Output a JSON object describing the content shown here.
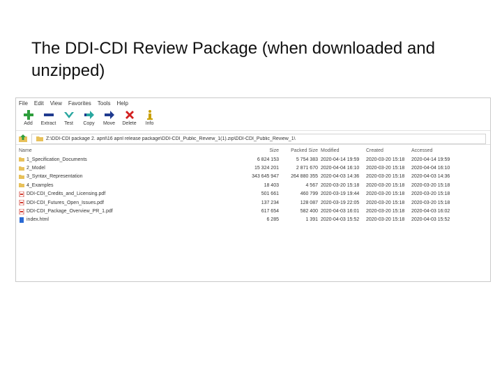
{
  "slide": {
    "title": "The DDI-CDI Review Package (when downloaded and unzipped)"
  },
  "menu": [
    "File",
    "Edit",
    "View",
    "Favorites",
    "Tools",
    "Help"
  ],
  "toolbar": [
    {
      "label": "Add",
      "icon": "add-icon"
    },
    {
      "label": "Extract",
      "icon": "extract-icon"
    },
    {
      "label": "Test",
      "icon": "test-icon"
    },
    {
      "label": "Copy",
      "icon": "copy-icon"
    },
    {
      "label": "Move",
      "icon": "move-icon"
    },
    {
      "label": "Delete",
      "icon": "delete-icon"
    },
    {
      "label": "Info",
      "icon": "info-icon"
    }
  ],
  "address": {
    "path": "Z:\\DDI-CDI package 2. april\\16 april release package\\DDI-CDI_Public_Review_1(1).zip\\DDI-CDI_Public_Review_1\\"
  },
  "columns": {
    "name": "Name",
    "size": "Size",
    "packed": "Packed Size",
    "modified": "Modified",
    "created": "Created",
    "accessed": "Accessed"
  },
  "files": [
    {
      "name": "1_Specification_Documents",
      "size": "6 824 153",
      "packed": "5 754 383",
      "modified": "2020-04-14 19:59",
      "created": "2020-03-20 15:18",
      "accessed": "2020-04-14 19:59",
      "type": "folder"
    },
    {
      "name": "2_Model",
      "size": "15 324 201",
      "packed": "2 871 670",
      "modified": "2020-04-04 16:10",
      "created": "2020-03-20 15:18",
      "accessed": "2020-04-04 16:10",
      "type": "folder"
    },
    {
      "name": "3_Syntax_Representation",
      "size": "343 645 947",
      "packed": "264 880 355",
      "modified": "2020-04-03 14:36",
      "created": "2020-03-20 15:18",
      "accessed": "2020-04-03 14:36",
      "type": "folder"
    },
    {
      "name": "4_Examples",
      "size": "18 403",
      "packed": "4 567",
      "modified": "2020-03-20 15:18",
      "created": "2020-03-20 15:18",
      "accessed": "2020-03-20 15:18",
      "type": "folder"
    },
    {
      "name": "DDI-CDI_Credits_and_Licensing.pdf",
      "size": "501 661",
      "packed": "460 799",
      "modified": "2020-03-19 19:44",
      "created": "2020-03-20 15:18",
      "accessed": "2020-03-20 15:18",
      "type": "pdf"
    },
    {
      "name": "DDI-CDI_Futures_Open_Issues.pdf",
      "size": "137 234",
      "packed": "128 087",
      "modified": "2020-03-19 22:05",
      "created": "2020-03-20 15:18",
      "accessed": "2020-03-20 15:18",
      "type": "pdf"
    },
    {
      "name": "DDI-CDI_Package_Overview_PR_1.pdf",
      "size": "617 654",
      "packed": "582 400",
      "modified": "2020-04-03 16:01",
      "created": "2020-03-20 15:18",
      "accessed": "2020-04-03 16:02",
      "type": "pdf"
    },
    {
      "name": "index.html",
      "size": "6 285",
      "packed": "1 391",
      "modified": "2020-04-03 15:52",
      "created": "2020-03-20 15:18",
      "accessed": "2020-04-03 15:52",
      "type": "html"
    }
  ],
  "colors": {
    "folder": "#e8c15a",
    "pdf": "#d13b2f",
    "html": "#2a6ad4",
    "add": "#2e9e3c",
    "extract": "#1f3a8f",
    "test": "#2aa7a0",
    "delete": "#d32020",
    "info": "#c9a000"
  }
}
